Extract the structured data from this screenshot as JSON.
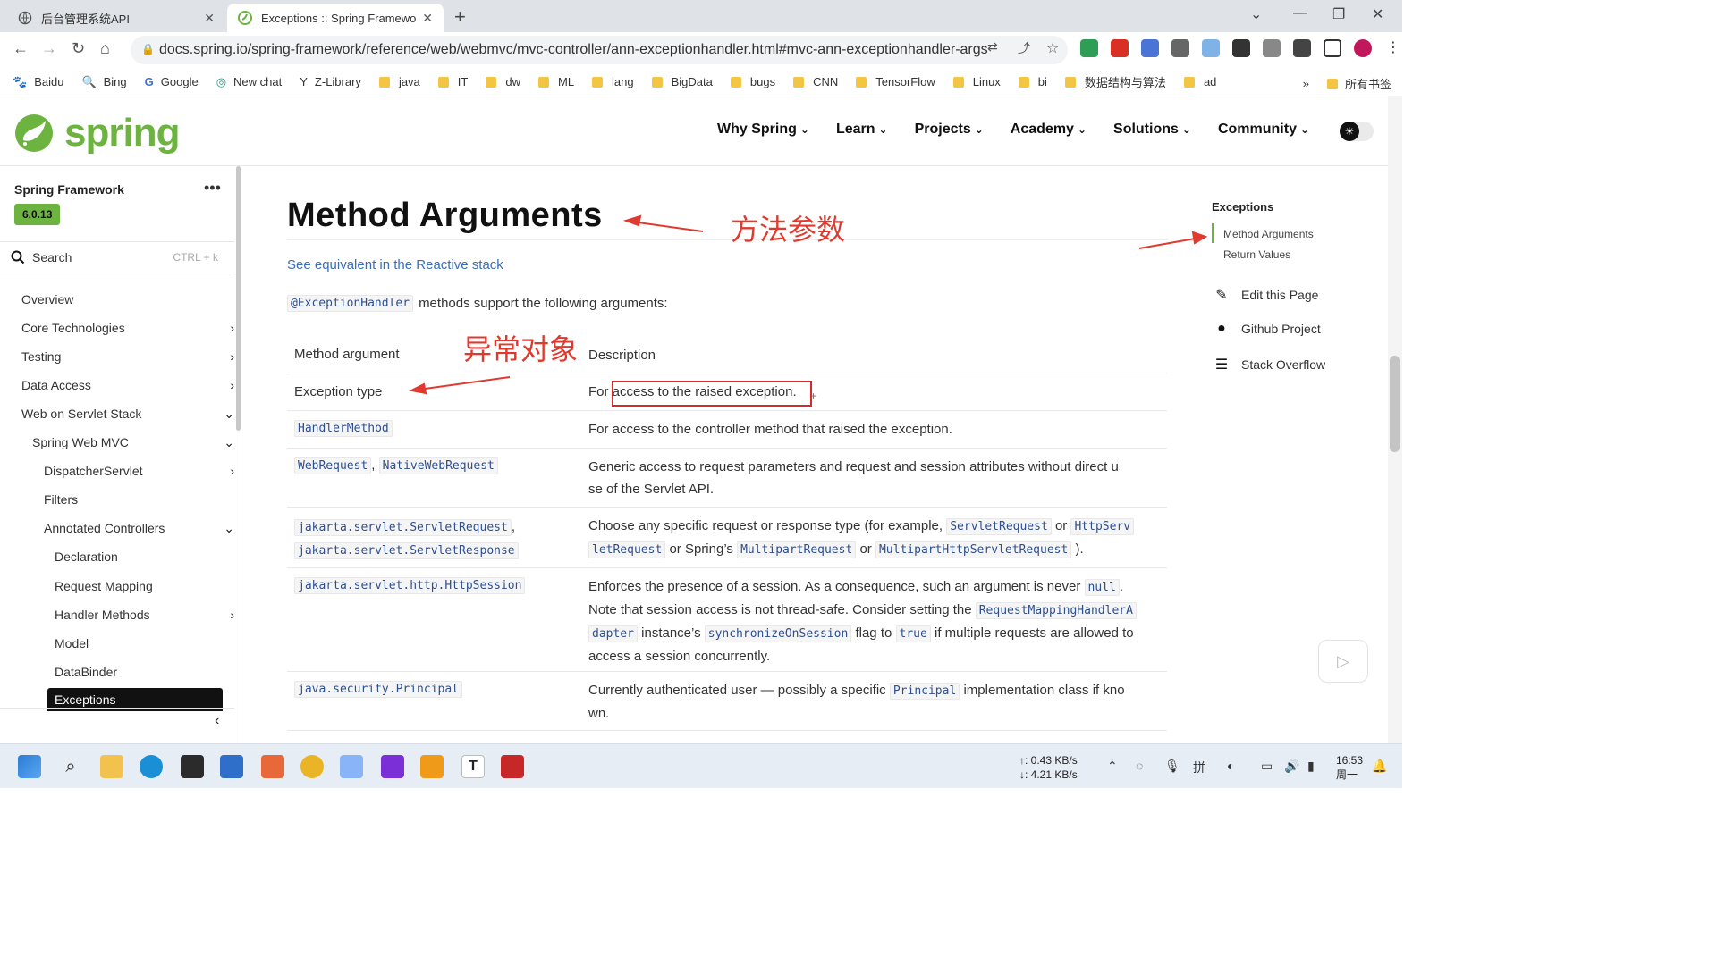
{
  "browser": {
    "tabs": [
      {
        "title": "后台管理系统API",
        "active": false
      },
      {
        "title": "Exceptions :: Spring Framewo",
        "active": true
      }
    ],
    "url": "docs.spring.io/spring-framework/reference/web/webmvc/mvc-controller/ann-exceptionhandler.html#mvc-ann-exceptionhandler-args",
    "bookmarks": [
      "Baidu",
      "Bing",
      "Google",
      "New chat",
      "Z-Library",
      "java",
      "IT",
      "dw",
      "ML",
      "lang",
      "BigData",
      "bugs",
      "CNN",
      "TensorFlow",
      "Linux",
      "bi",
      "数据结构与算法",
      "ad"
    ],
    "bookmarks_more": "»",
    "all_bookmarks": "所有书签"
  },
  "site": {
    "logo_text": "spring",
    "nav": [
      "Why Spring",
      "Learn",
      "Projects",
      "Academy",
      "Solutions",
      "Community"
    ]
  },
  "sidebar": {
    "title": "Spring Framework",
    "version": "6.0.13",
    "search_label": "Search",
    "search_hint": "CTRL + k",
    "items": [
      {
        "label": "Overview",
        "level": 0,
        "arrow": ""
      },
      {
        "label": "Core Technologies",
        "level": 0,
        "arrow": "›"
      },
      {
        "label": "Testing",
        "level": 0,
        "arrow": "›"
      },
      {
        "label": "Data Access",
        "level": 0,
        "arrow": "›"
      },
      {
        "label": "Web on Servlet Stack",
        "level": 0,
        "arrow": "⌄"
      },
      {
        "label": "Spring Web MVC",
        "level": 1,
        "arrow": "⌄"
      },
      {
        "label": "DispatcherServlet",
        "level": 2,
        "arrow": "›"
      },
      {
        "label": "Filters",
        "level": 2,
        "arrow": ""
      },
      {
        "label": "Annotated Controllers",
        "level": 2,
        "arrow": "⌄"
      },
      {
        "label": "Declaration",
        "level": 3,
        "arrow": ""
      },
      {
        "label": "Request Mapping",
        "level": 3,
        "arrow": ""
      },
      {
        "label": "Handler Methods",
        "level": 3,
        "arrow": "›"
      },
      {
        "label": "Model",
        "level": 3,
        "arrow": ""
      },
      {
        "label": "DataBinder",
        "level": 3,
        "arrow": ""
      },
      {
        "label": "Exceptions",
        "level": 3,
        "arrow": "",
        "active": true
      }
    ]
  },
  "main": {
    "heading": "Method Arguments",
    "reactive_link": "See equivalent in the Reactive stack",
    "intro_code": "@ExceptionHandler",
    "intro_text": "methods support the following arguments:",
    "col_arg": "Method argument",
    "col_desc": "Description",
    "rows": {
      "r1": {
        "arg": "Exception type",
        "desc_pre": "For ",
        "desc_hl": "access to the raised exception."
      },
      "r2": {
        "arg": "HandlerMethod",
        "desc": "For access to the controller method that raised the exception."
      },
      "r3": {
        "arg1": "WebRequest",
        "sep": ",",
        "arg2": "NativeWebRequest",
        "desc_l1": "Generic access to request parameters and request and session attributes without direct u",
        "desc_l2": "se of the Servlet API."
      },
      "r4": {
        "arg1": "jakarta.servlet.ServletRequest",
        "sep": ",",
        "arg2": "jakarta.servlet.ServletResponse",
        "d1": "Choose any specific request or response type (for example,",
        "c1": "ServletRequest",
        "d2": "or",
        "c2a": "HttpServ",
        "c2b": "letRequest",
        "d3": "or Spring’s",
        "c3": "MultipartRequest",
        "d4": "or",
        "c4": "MultipartHttpServletRequest",
        "d5": ")."
      },
      "r5": {
        "arg": "jakarta.servlet.http.HttpSession",
        "d1": "Enforces the presence of a session. As a consequence, such an argument is never",
        "c1": "null",
        "d1b": ".",
        "d2": "Note that session access is not thread-safe. Consider setting the",
        "c2a": "RequestMappingHandlerA",
        "c2b": "dapter",
        "d3": "instance’s",
        "c3": "synchronizeOnSession",
        "d4": "flag to",
        "c4": "true",
        "d5": "if multiple requests are allowed to",
        "d6": "access a session concurrently."
      },
      "r6": {
        "arg": "java.security.Principal",
        "d1": "Currently authenticated user — possibly a specific",
        "c1": "Principal",
        "d2": "implementation class if kno",
        "d3": "wn."
      }
    }
  },
  "annotations": {
    "method_params": "方法参数",
    "exception_obj": "异常对象",
    "color": "#e03a2e"
  },
  "toc": {
    "title": "Exceptions",
    "items": [
      "Method Arguments",
      "Return Values"
    ],
    "links": [
      "Edit this Page",
      "Github Project",
      "Stack Overflow"
    ]
  },
  "taskbar": {
    "net_up": "↑: 0.43 KB/s",
    "net_down": "↓: 4.21 KB/s",
    "time": "16:53",
    "date": "周一"
  }
}
